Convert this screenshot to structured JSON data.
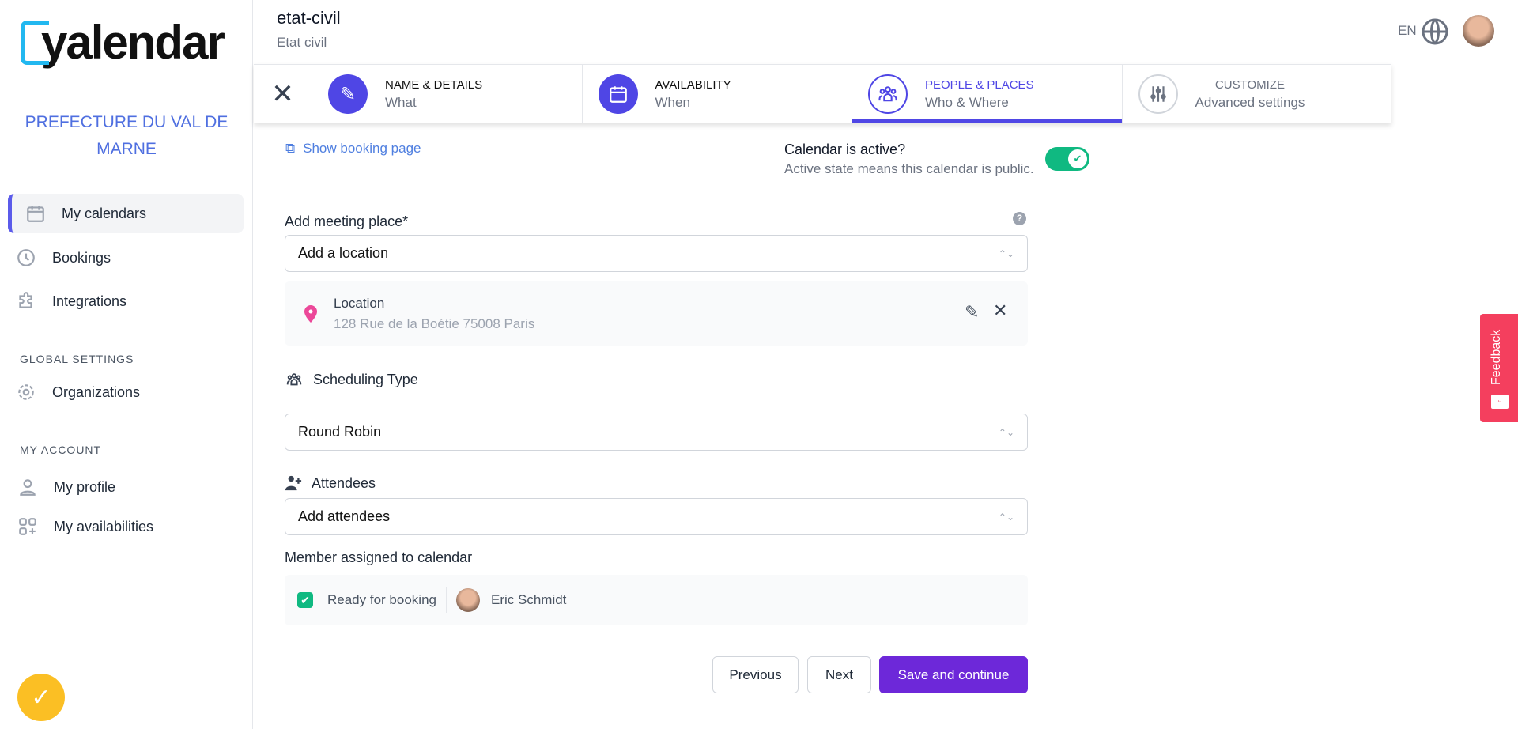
{
  "brand": {
    "logo_text": "yalendar",
    "org_name": "PREFECTURE DU VAL DE MARNE"
  },
  "sidebar": {
    "items": [
      {
        "label": "My calendars",
        "icon": "calendar-icon",
        "active": true
      },
      {
        "label": "Bookings",
        "icon": "clock-icon"
      },
      {
        "label": "Integrations",
        "icon": "puzzle-icon"
      }
    ],
    "global_title": "GLOBAL SETTINGS",
    "global_items": [
      {
        "label": "Organizations",
        "icon": "gear-icon"
      }
    ],
    "account_title": "MY ACCOUNT",
    "account_items": [
      {
        "label": "My profile",
        "icon": "user-icon"
      },
      {
        "label": "My availabilities",
        "icon": "grid-plus-icon"
      }
    ]
  },
  "header": {
    "title": "etat-civil",
    "subtitle": "Etat civil",
    "lang": "EN"
  },
  "stepper": [
    {
      "title": "NAME & DETAILS",
      "subtitle": "What",
      "state": "done"
    },
    {
      "title": "AVAILABILITY",
      "subtitle": "When",
      "state": "done"
    },
    {
      "title": "PEOPLE & PLACES",
      "subtitle": "Who & Where",
      "state": "active"
    },
    {
      "title": "CUSTOMIZE",
      "subtitle": "Advanced settings",
      "state": "pending"
    }
  ],
  "main": {
    "show_booking": "Show booking page",
    "active_title": "Calendar is active?",
    "active_desc": "Active state means this calendar is public.",
    "active_on": true,
    "meeting_label": "Add meeting place",
    "required": "*",
    "meeting_select": "Add a location",
    "location": {
      "title": "Location",
      "address": "128 Rue de la Boétie 75008 Paris"
    },
    "scheduling_label": "Scheduling Type",
    "scheduling_value": "Round Robin",
    "attendees_label": "Attendees",
    "attendees_select": "Add attendees",
    "member_label": "Member assigned to calendar",
    "member": {
      "status": "Ready for booking",
      "checked": true,
      "name": "Eric Schmidt"
    },
    "buttons": {
      "previous": "Previous",
      "next": "Next",
      "save": "Save and continue"
    }
  },
  "feedback": "Feedback",
  "colors": {
    "primary": "#4f46e5",
    "save": "#6d28d9",
    "toggle": "#10b981",
    "feedback": "#f43f5e"
  }
}
